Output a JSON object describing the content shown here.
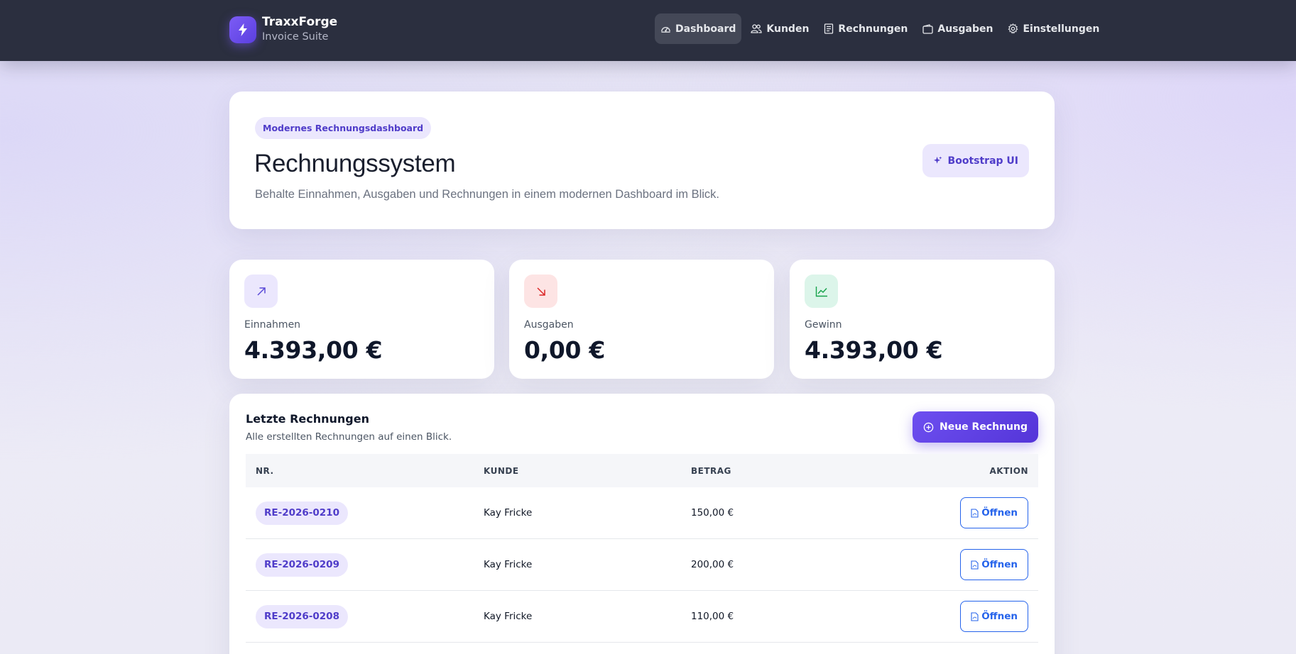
{
  "brand": {
    "name": "TraxxForge",
    "subtitle": "Invoice Suite",
    "icon": "lightning-icon",
    "accent": "#6d4ff0"
  },
  "nav": [
    {
      "label": "Dashboard",
      "icon": "dashboard-icon",
      "active": true
    },
    {
      "label": "Kunden",
      "icon": "people-icon",
      "active": false
    },
    {
      "label": "Rechnungen",
      "icon": "receipt-icon",
      "active": false
    },
    {
      "label": "Ausgaben",
      "icon": "wallet-icon",
      "active": false
    },
    {
      "label": "Einstellungen",
      "icon": "gear-icon",
      "active": false
    }
  ],
  "hero": {
    "badge": "Modernes Rechnungsdashboard",
    "title": "Rechnungssystem",
    "subtitle": "Behalte Einnahmen, Ausgaben und Rechnungen in einem modernen Dashboard im Blick.",
    "pill": "Bootstrap UI"
  },
  "stats": [
    {
      "label": "Einnahmen",
      "value": "4.393,00 €",
      "icon": "arrow-up-right-icon",
      "color": "#5b4bd8",
      "bg": "#ebe7fd"
    },
    {
      "label": "Ausgaben",
      "value": "0,00 €",
      "icon": "arrow-down-right-icon",
      "color": "#dc2626",
      "bg": "#fde4e4"
    },
    {
      "label": "Gewinn",
      "value": "4.393,00 €",
      "icon": "graph-up-icon",
      "color": "#16a34a",
      "bg": "#dcf5ea"
    }
  ],
  "invoices": {
    "title": "Letzte Rechnungen",
    "subtitle": "Alle erstellten Rechnungen auf einen Blick.",
    "new_button": "Neue Rechnung",
    "columns": [
      "NR.",
      "KUNDE",
      "BETRAG",
      "AKTION"
    ],
    "rows": [
      {
        "nr": "RE-2026-0210",
        "kunde": "Kay Fricke",
        "betrag": "150,00 €",
        "action": "Öffnen"
      },
      {
        "nr": "RE-2026-0209",
        "kunde": "Kay Fricke",
        "betrag": "200,00 €",
        "action": "Öffnen"
      },
      {
        "nr": "RE-2026-0208",
        "kunde": "Kay Fricke",
        "betrag": "110,00 €",
        "action": "Öffnen"
      }
    ]
  }
}
